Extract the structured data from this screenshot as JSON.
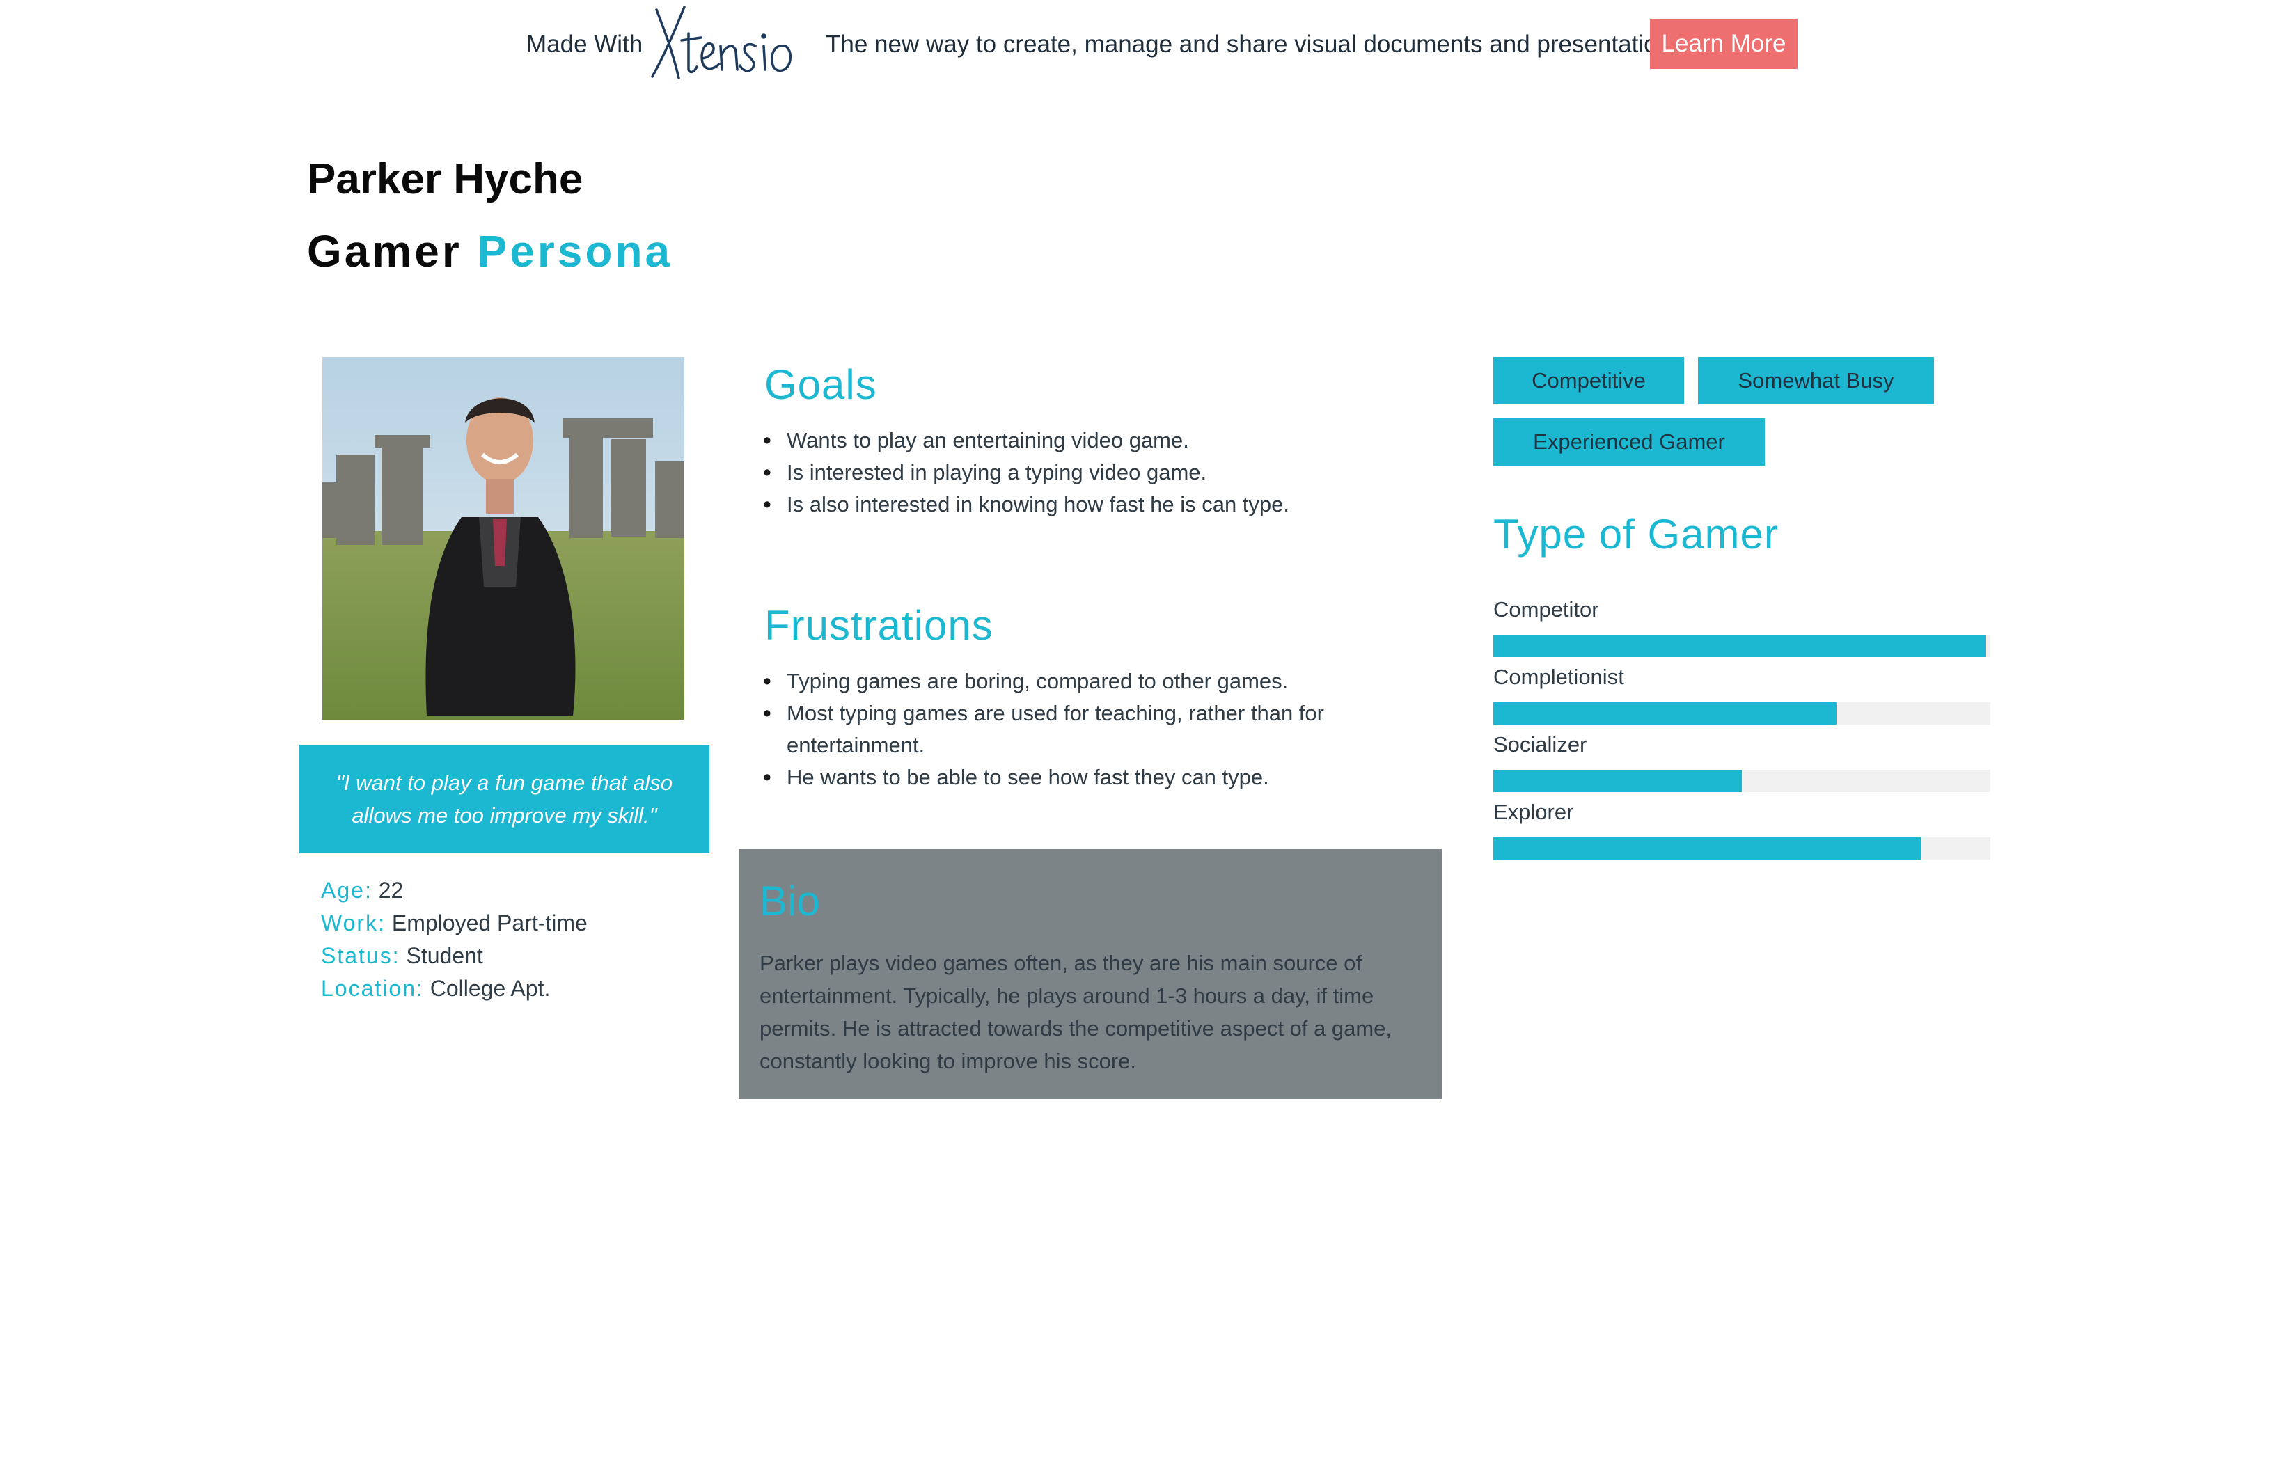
{
  "banner": {
    "made_with": "Made With",
    "logo_text": "Xtensio",
    "tagline": "The new way to create, manage and share visual documents and presentations.",
    "learn_more": "Learn More"
  },
  "persona": {
    "name": "Parker Hyche",
    "subtitle_prefix": "Gamer",
    "subtitle_accent": "Persona"
  },
  "quote": "\"I want to play a fun game that also allows me too improve my skill.\"",
  "facts": [
    {
      "key": "Age:",
      "value": "22"
    },
    {
      "key": "Work:",
      "value": "Employed Part-time"
    },
    {
      "key": "Status:",
      "value": "Student"
    },
    {
      "key": "Location:",
      "value": "College Apt."
    }
  ],
  "goals": {
    "title": "Goals",
    "items": [
      "Wants to play an entertaining video game.",
      "Is interested in playing a typing video game.",
      "Is also interested in knowing how fast he is can type."
    ]
  },
  "frustrations": {
    "title": "Frustrations",
    "items": [
      "Typing games are boring, compared to other games.",
      "Most typing games are used for teaching, rather than for entertainment.",
      "He wants to be able to see how fast they can type."
    ]
  },
  "bio": {
    "title": "Bio",
    "text": "Parker plays video games often, as they are his main source of entertainment. Typically, he plays around 1-3 hours a day, if time permits. He is attracted towards the competitive aspect of a game, constantly looking to improve his score."
  },
  "tags": [
    "Competitive",
    "Somewhat Busy",
    "Experienced Gamer"
  ],
  "gamer_type": {
    "title": "Type of Gamer",
    "bars": [
      {
        "label": "Competitor",
        "value": 0.99
      },
      {
        "label": "Completionist",
        "value": 0.69
      },
      {
        "label": "Socializer",
        "value": 0.5
      },
      {
        "label": "Explorer",
        "value": 0.86
      }
    ]
  },
  "colors": {
    "accent": "#1cb8d2",
    "learn_button": "#ee6f6f",
    "bio_background": "#7d8488",
    "bar_track": "#f1f1f1"
  }
}
